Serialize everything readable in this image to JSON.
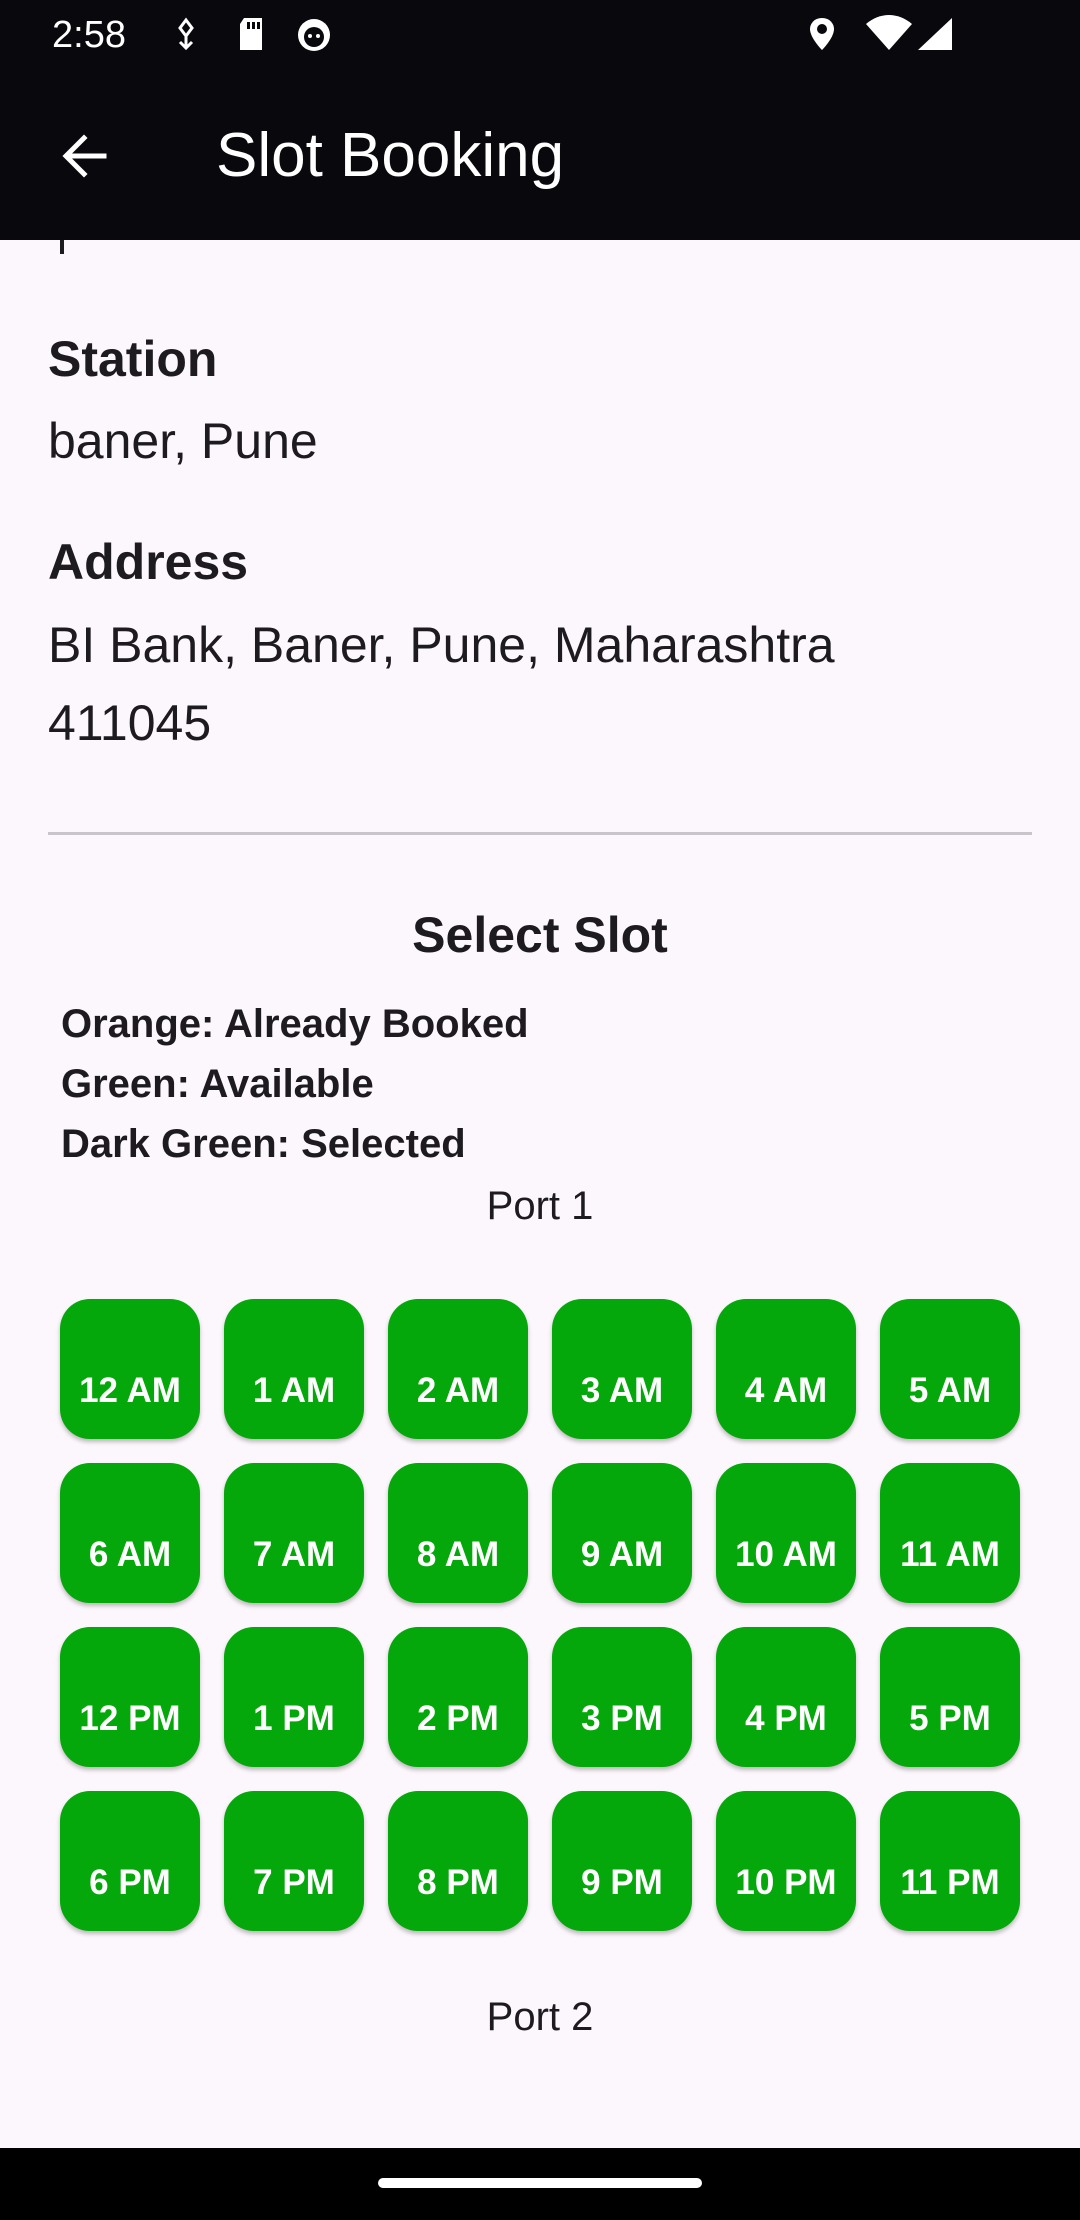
{
  "status_bar": {
    "time": "2:58",
    "left_icons": [
      "usb-debug-icon",
      "sd-card-icon",
      "cat-app-icon"
    ],
    "right_icons": [
      "location-icon",
      "wifi-icon",
      "signal-icon"
    ]
  },
  "app_bar": {
    "back_icon": "arrow-back-icon",
    "title": "Slot Booking"
  },
  "details": {
    "station_label": "Station",
    "station_value": "baner, Pune",
    "address_label": "Address",
    "address_value": "BI Bank, Baner, Pune, Maharashtra 411045"
  },
  "slot_section": {
    "title": "Select Slot",
    "legend": [
      "Orange: Already Booked",
      "Green: Available",
      "Dark Green: Selected"
    ],
    "colors": {
      "available": "#05a80a",
      "booked": "orange",
      "selected": "darkgreen"
    },
    "ports": [
      {
        "label": "Port 1",
        "slots": [
          "12 AM",
          "1 AM",
          "2 AM",
          "3 AM",
          "4 AM",
          "5 AM",
          "6 AM",
          "7 AM",
          "8 AM",
          "9 AM",
          "10 AM",
          "11 AM",
          "12 PM",
          "1 PM",
          "2 PM",
          "3 PM",
          "4 PM",
          "5 PM",
          "6 PM",
          "7 PM",
          "8 PM",
          "9 PM",
          "10 PM",
          "11 PM"
        ]
      },
      {
        "label": "Port 2"
      }
    ]
  }
}
